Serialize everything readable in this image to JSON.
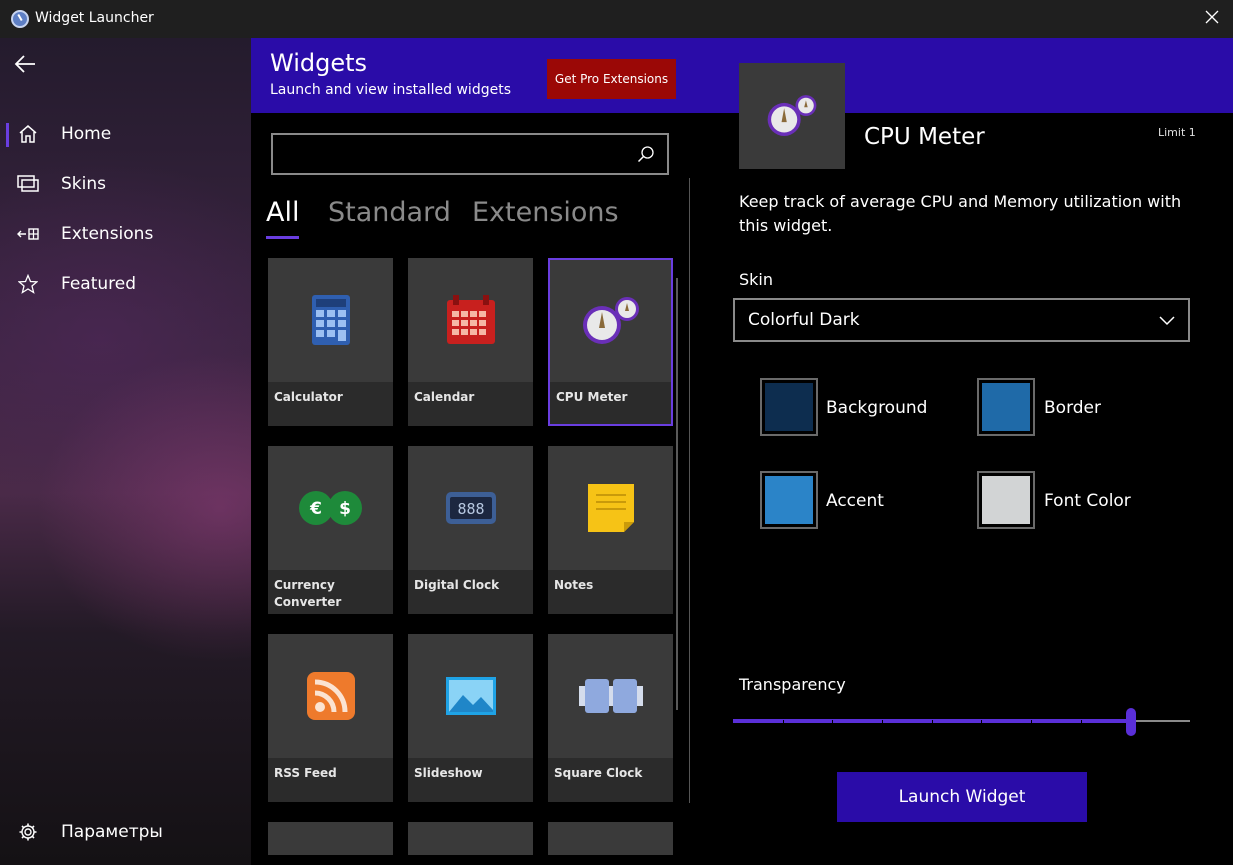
{
  "window": {
    "title": "Widget Launcher",
    "icon": "clock-icon",
    "close_icon": "close-icon"
  },
  "sidebar": {
    "back_icon": "back-arrow-icon",
    "items": [
      {
        "label": "Home",
        "icon": "home-icon",
        "active": true
      },
      {
        "label": "Skins",
        "icon": "skins-icon",
        "active": false
      },
      {
        "label": "Extensions",
        "icon": "extensions-icon",
        "active": false
      },
      {
        "label": "Featured",
        "icon": "star-icon",
        "active": false
      }
    ],
    "settings": {
      "label": "Параметры",
      "icon": "gear-icon"
    }
  },
  "header": {
    "title": "Widgets",
    "subtitle": "Launch and view installed widgets",
    "pro_button": "Get Pro Extensions"
  },
  "search": {
    "value": "",
    "placeholder": "",
    "icon": "search-icon"
  },
  "tabs": [
    {
      "label": "All",
      "active": true
    },
    {
      "label": "Standard",
      "active": false
    },
    {
      "label": "Extensions",
      "active": false
    }
  ],
  "widgets": [
    {
      "name": "Calculator",
      "icon": "calculator-icon"
    },
    {
      "name": "Calendar",
      "icon": "calendar-icon"
    },
    {
      "name": "CPU Meter",
      "icon": "cpu-meter-icon",
      "selected": true
    },
    {
      "name": "Currency Converter",
      "icon": "currency-icon"
    },
    {
      "name": "Digital Clock",
      "icon": "digital-clock-icon"
    },
    {
      "name": "Notes",
      "icon": "notes-icon"
    },
    {
      "name": "RSS Feed",
      "icon": "rss-icon"
    },
    {
      "name": "Slideshow",
      "icon": "slideshow-icon"
    },
    {
      "name": "Square Clock",
      "icon": "square-clock-icon"
    }
  ],
  "details": {
    "name": "CPU Meter",
    "limit": "Limit 1",
    "description": "Keep track of average CPU and Memory utilization with this widget.",
    "skin_label": "Skin",
    "skin_value": "Colorful Dark",
    "colors": [
      {
        "label": "Background",
        "hex": "#0d2d4f"
      },
      {
        "label": "Border",
        "hex": "#1f6aa8"
      },
      {
        "label": "Accent",
        "hex": "#2b84c8"
      },
      {
        "label": "Font Color",
        "hex": "#d2d4d5"
      }
    ],
    "transparency_label": "Transparency",
    "transparency_value": 0.88,
    "launch_button": "Launch Widget"
  },
  "colors": {
    "accent": "#6a3ee0",
    "header": "#2a0ca8",
    "pro": "#9b0806"
  }
}
